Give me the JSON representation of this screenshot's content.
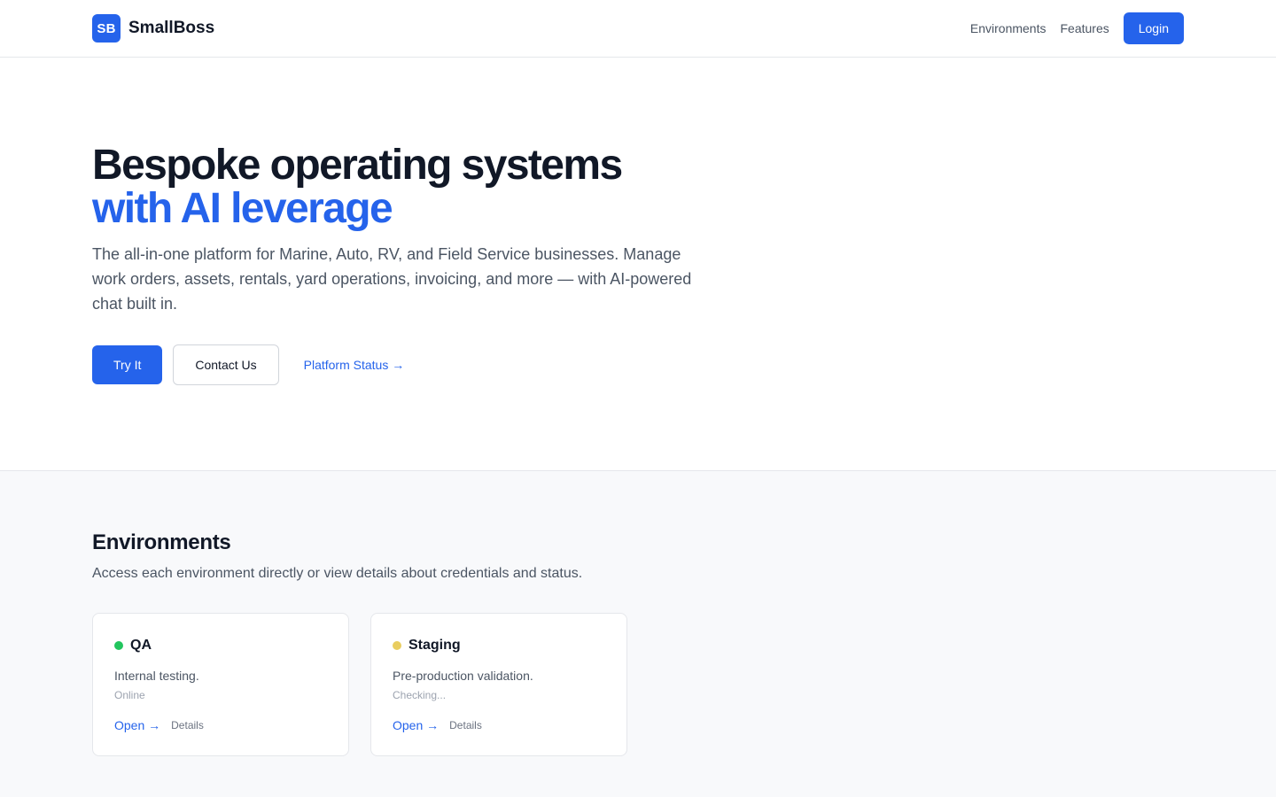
{
  "header": {
    "logo_mark": "SB",
    "brand_name": "SmallBoss",
    "nav": [
      {
        "label": "Environments"
      },
      {
        "label": "Features"
      }
    ],
    "login_label": "Login"
  },
  "hero": {
    "title_line1": "Bespoke operating systems",
    "title_line2": "with AI leverage",
    "description": "The all-in-one platform for Marine, Auto, RV, and Field Service businesses. Manage work orders, assets, rentals, yard operations, invoicing, and more — with AI-powered chat built in.",
    "primary_cta": "Try It",
    "secondary_cta": "Contact Us",
    "status_link": "Platform Status →"
  },
  "environments": {
    "title": "Environments",
    "subtitle": "Access each environment directly or view details about credentials and status.",
    "cards": [
      {
        "name": "QA",
        "description": "Internal testing.",
        "status": "Online",
        "status_color": "#22c55e",
        "open_label": "Open →",
        "details_label": "Details"
      },
      {
        "name": "Staging",
        "description": "Pre-production validation.",
        "status": "Checking...",
        "status_color": "#e9cd5f",
        "open_label": "Open →",
        "details_label": "Details"
      }
    ]
  },
  "colors": {
    "accent": "#2563eb",
    "text_primary": "#111827",
    "text_secondary": "#4b5563",
    "border": "#e5e7eb",
    "section_bg": "#f8f9fb"
  }
}
